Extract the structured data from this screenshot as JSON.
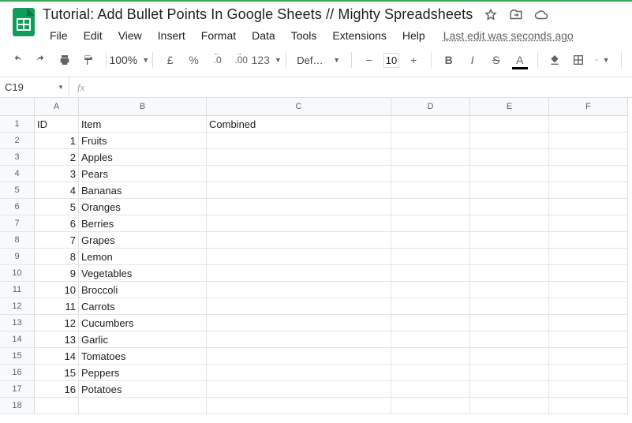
{
  "title": "Tutorial: Add Bullet Points In Google Sheets // Mighty Spreadsheets",
  "menu": {
    "file": "File",
    "edit": "Edit",
    "view": "View",
    "insert": "Insert",
    "format": "Format",
    "data": "Data",
    "tools": "Tools",
    "extensions": "Extensions",
    "help": "Help"
  },
  "lastEdit": "Last edit was seconds ago",
  "toolbar": {
    "zoom": "100%",
    "currency": "£",
    "percent": "%",
    "dec_dec": ".0",
    "dec_inc": ".00",
    "numfmt": "123",
    "font": "Default (Ari...",
    "fontsize": "10",
    "textA": "A"
  },
  "nameBox": "C19",
  "fx": "fx",
  "fxValue": "",
  "columns": [
    "A",
    "B",
    "C",
    "D",
    "E",
    "F"
  ],
  "rowCount": 18,
  "headers": {
    "A": "ID",
    "B": "Item",
    "C": "Combined"
  },
  "rows": [
    {
      "id": "1",
      "item": "Fruits"
    },
    {
      "id": "2",
      "item": "Apples"
    },
    {
      "id": "3",
      "item": "Pears"
    },
    {
      "id": "4",
      "item": "Bananas"
    },
    {
      "id": "5",
      "item": "Oranges"
    },
    {
      "id": "6",
      "item": "Berries"
    },
    {
      "id": "7",
      "item": "Grapes"
    },
    {
      "id": "8",
      "item": "Lemon"
    },
    {
      "id": "9",
      "item": "Vegetables"
    },
    {
      "id": "10",
      "item": "Broccoli"
    },
    {
      "id": "11",
      "item": "Carrots"
    },
    {
      "id": "12",
      "item": "Cucumbers"
    },
    {
      "id": "13",
      "item": "Garlic"
    },
    {
      "id": "14",
      "item": "Tomatoes"
    },
    {
      "id": "15",
      "item": "Peppers"
    },
    {
      "id": "16",
      "item": "Potatoes"
    }
  ]
}
